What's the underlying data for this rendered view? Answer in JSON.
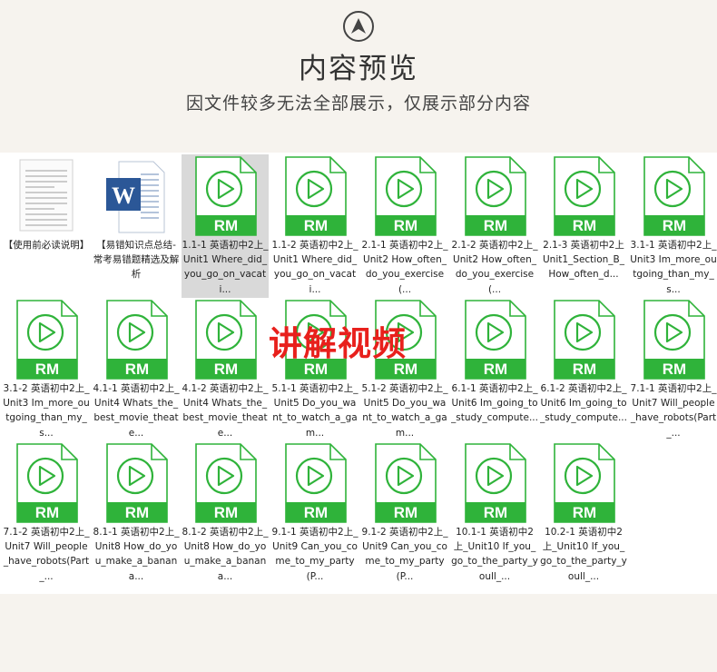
{
  "header": {
    "title": "内容预览",
    "subtitle": "因文件较多无法全部展示，仅展示部分内容"
  },
  "overlay_text": "讲解视频",
  "colors": {
    "rm_green": "#2fb33a",
    "overlay_red": "#e8201c",
    "word_blue": "#2b5797"
  },
  "files": [
    {
      "icon": "text-document-icon",
      "label": "【使用前必读说明】",
      "selected": false
    },
    {
      "icon": "word-document-icon",
      "label": "【易错知识点总结-常考易错题精选及解析",
      "selected": false
    },
    {
      "icon": "rm-video-icon",
      "label": "1.1-1 英语初中2上_Unit1 Where_did_you_go_on_vacati...",
      "selected": true
    },
    {
      "icon": "rm-video-icon",
      "label": "1.1-2 英语初中2上_Unit1 Where_did_you_go_on_vacati...",
      "selected": false
    },
    {
      "icon": "rm-video-icon",
      "label": "2.1-1 英语初中2上_Unit2 How_often_do_you_exercise(...",
      "selected": false
    },
    {
      "icon": "rm-video-icon",
      "label": "2.1-2 英语初中2上_Unit2 How_often_do_you_exercise(...",
      "selected": false
    },
    {
      "icon": "rm-video-icon",
      "label": "2.1-3 英语初中2上 Unit1_Section_B_How_often_d...",
      "selected": false
    },
    {
      "icon": "rm-video-icon",
      "label": "3.1-1 英语初中2上_Unit3 Im_more_outgoing_than_my_s...",
      "selected": false
    },
    {
      "icon": "rm-video-icon",
      "label": "3.1-2 英语初中2上_Unit3 Im_more_outgoing_than_my_s...",
      "selected": false
    },
    {
      "icon": "rm-video-icon",
      "label": "4.1-1 英语初中2上_Unit4 Whats_the_best_movie_theate...",
      "selected": false
    },
    {
      "icon": "rm-video-icon",
      "label": "4.1-2 英语初中2上_Unit4 Whats_the_best_movie_theate...",
      "selected": false
    },
    {
      "icon": "rm-video-icon",
      "label": "5.1-1 英语初中2上_Unit5 Do_you_want_to_watch_a_gam...",
      "selected": false
    },
    {
      "icon": "rm-video-icon",
      "label": "5.1-2 英语初中2上_Unit5 Do_you_want_to_watch_a_gam...",
      "selected": false
    },
    {
      "icon": "rm-video-icon",
      "label": "6.1-1 英语初中2上_Unit6 Im_going_to_study_compute...",
      "selected": false
    },
    {
      "icon": "rm-video-icon",
      "label": "6.1-2 英语初中2上_Unit6 Im_going_to_study_compute...",
      "selected": false
    },
    {
      "icon": "rm-video-icon",
      "label": "7.1-1 英语初中2上_Unit7 Will_people_have_robots(Part_...",
      "selected": false
    },
    {
      "icon": "rm-video-icon",
      "label": "7.1-2 英语初中2上_Unit7 Will_people_have_robots(Part_...",
      "selected": false
    },
    {
      "icon": "rm-video-icon",
      "label": "8.1-1 英语初中2上_Unit8 How_do_you_make_a_banana...",
      "selected": false
    },
    {
      "icon": "rm-video-icon",
      "label": "8.1-2 英语初中2上_Unit8 How_do_you_make_a_banana...",
      "selected": false
    },
    {
      "icon": "rm-video-icon",
      "label": "9.1-1 英语初中2上_Unit9 Can_you_come_to_my_party(P...",
      "selected": false
    },
    {
      "icon": "rm-video-icon",
      "label": "9.1-2 英语初中2上_Unit9 Can_you_come_to_my_party(P...",
      "selected": false
    },
    {
      "icon": "rm-video-icon",
      "label": "10.1-1 英语初中2上_Unit10 If_you_go_to_the_party_youll_...",
      "selected": false
    },
    {
      "icon": "rm-video-icon",
      "label": "10.2-1 英语初中2上_Unit10 If_you_go_to_the_party_youll_...",
      "selected": false
    }
  ],
  "rm_badge": "RM",
  "word_badge": "W"
}
